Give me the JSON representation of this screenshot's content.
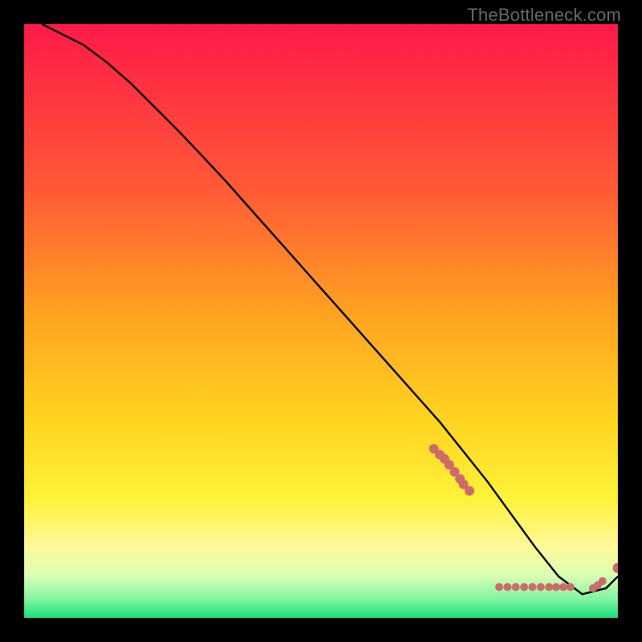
{
  "watermark": "TheBottleneck.com",
  "colors": {
    "bg": "#000000",
    "curve": "#000000",
    "dot": "#cc6b6a",
    "grad_top": "#ff1a49",
    "grad_mid1": "#ff6a2f",
    "grad_mid2": "#ffd21f",
    "grad_mid3": "#fff99a",
    "grad_mid4": "#d6ffb0",
    "grad_bottom": "#18e07a"
  },
  "chart_data": {
    "type": "line",
    "title": "",
    "xlabel": "",
    "ylabel": "",
    "xlim": [
      0,
      100
    ],
    "ylim": [
      0,
      100
    ],
    "series": [
      {
        "name": "curve",
        "x": [
          3,
          6,
          10,
          14,
          18,
          22,
          26,
          30,
          34,
          38,
          42,
          46,
          50,
          54,
          58,
          62,
          66,
          70,
          74,
          78,
          82,
          86,
          90,
          94,
          98,
          100
        ],
        "y": [
          100,
          98.5,
          96.5,
          93.5,
          90,
          86,
          82,
          77.8,
          73.5,
          69,
          64.5,
          60,
          55.5,
          51,
          46.5,
          42,
          37.5,
          33,
          28,
          23,
          17.5,
          12,
          7,
          4,
          5,
          7
        ]
      }
    ],
    "dot_clusters": [
      {
        "where": "upper-segment",
        "points": [
          {
            "x": 69.0,
            "y": 28.5
          },
          {
            "x": 70.0,
            "y": 27.5
          },
          {
            "x": 70.8,
            "y": 26.8
          },
          {
            "x": 71.6,
            "y": 25.8
          },
          {
            "x": 72.5,
            "y": 24.6
          },
          {
            "x": 73.4,
            "y": 23.4
          },
          {
            "x": 74.0,
            "y": 22.5
          },
          {
            "x": 75.0,
            "y": 21.4
          }
        ]
      },
      {
        "where": "valley",
        "points": [
          {
            "x": 80.0,
            "y": 5.2
          },
          {
            "x": 81.4,
            "y": 5.2
          },
          {
            "x": 82.8,
            "y": 5.2
          },
          {
            "x": 84.2,
            "y": 5.2
          },
          {
            "x": 85.6,
            "y": 5.2
          },
          {
            "x": 87.0,
            "y": 5.2
          },
          {
            "x": 88.4,
            "y": 5.2
          },
          {
            "x": 89.6,
            "y": 5.2
          },
          {
            "x": 90.8,
            "y": 5.2
          },
          {
            "x": 92.0,
            "y": 5.2
          }
        ]
      },
      {
        "where": "uptick",
        "points": [
          {
            "x": 95.8,
            "y": 5.0
          },
          {
            "x": 96.6,
            "y": 5.5
          },
          {
            "x": 97.4,
            "y": 6.2
          }
        ]
      },
      {
        "where": "end-point",
        "points": [
          {
            "x": 100.0,
            "y": 8.4
          }
        ]
      }
    ]
  }
}
